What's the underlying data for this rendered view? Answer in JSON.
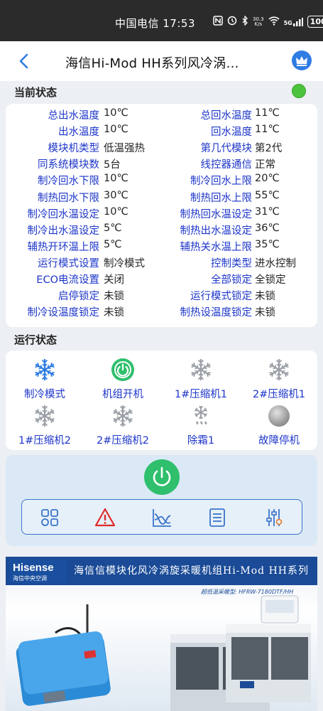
{
  "status_bar": {
    "carrier_time": "中国电信 17:53",
    "net_speed_value": "30.3",
    "net_speed_unit": "K/s",
    "signal_label": "5G",
    "battery": "100"
  },
  "header": {
    "title": "海信Hi-Mod HH系列风冷涡..."
  },
  "current_state": {
    "label": "当前状态",
    "indicator_color": "#4cc33c",
    "rows": [
      {
        "l1": "总出水温度",
        "v1": "10℃",
        "l2": "总回水温度",
        "v2": "11℃"
      },
      {
        "l1": "出水温度",
        "v1": "10℃",
        "l2": "回水温度",
        "v2": "11℃"
      },
      {
        "l1": "模块机类型",
        "v1": "低温强热",
        "l2": "第几代模块",
        "v2": "第2代"
      },
      {
        "l1": "同系统模块数",
        "v1": "5台",
        "l2": "线控器通信",
        "v2": "正常"
      },
      {
        "l1": "制冷回水下限",
        "v1": "10℃",
        "l2": "制冷回水上限",
        "v2": "20℃"
      },
      {
        "l1": "制热回水下限",
        "v1": "30℃",
        "l2": "制热回水上限",
        "v2": "55℃"
      },
      {
        "l1": "制冷回水温设定",
        "v1": "10℃",
        "l2": "制热回水温设定",
        "v2": "31℃"
      },
      {
        "l1": "制冷出水温设定",
        "v1": "5℃",
        "l2": "制热出水温设定",
        "v2": "36℃"
      },
      {
        "l1": "辅热开环温上限",
        "v1": "5℃",
        "l2": "辅热关水温上限",
        "v2": "35℃"
      },
      {
        "l1": "运行模式设置",
        "v1": "制冷模式",
        "l2": "控制类型",
        "v2": "进水控制"
      },
      {
        "l1": "ECO电流设置",
        "v1": "关闭",
        "l2": "全部锁定",
        "v2": "全锁定"
      },
      {
        "l1": "启停锁定",
        "v1": "未锁",
        "l2": "运行模式锁定",
        "v2": "未锁"
      },
      {
        "l1": "制冷设温度锁定",
        "v1": "未锁",
        "l2": "制热设温度锁定",
        "v2": "未锁"
      }
    ]
  },
  "run_state": {
    "label": "运行状态",
    "items": [
      {
        "label": "制冷模式",
        "icon": "snowflake-icon",
        "active": true
      },
      {
        "label": "机组开机",
        "icon": "power-icon",
        "active": true
      },
      {
        "label": "1#压缩机1",
        "icon": "snowflake-icon",
        "active": false
      },
      {
        "label": "2#压缩机1",
        "icon": "snowflake-icon",
        "active": false
      },
      {
        "label": "1#压缩机2",
        "icon": "snowflake-icon",
        "active": false
      },
      {
        "label": "2#压缩机2",
        "icon": "snowflake-icon",
        "active": false
      },
      {
        "label": "除霜1",
        "icon": "defrost-icon",
        "active": false
      },
      {
        "label": "故障停机",
        "icon": "fault-icon",
        "active": false
      }
    ]
  },
  "control": {
    "tools": [
      "grid-icon",
      "warning-icon",
      "chart-icon",
      "list-icon",
      "sliders-icon"
    ]
  },
  "banner": {
    "brand_name": "Hisense",
    "brand_sub": "海信中央空调",
    "title": "海信信模块化风冷涡旋采暖机组Hi-Mod HH系列",
    "model": "超低温采暖型: HFRW-7180DTF/HH",
    "colors": {
      "blue": "#1b4b97"
    }
  }
}
